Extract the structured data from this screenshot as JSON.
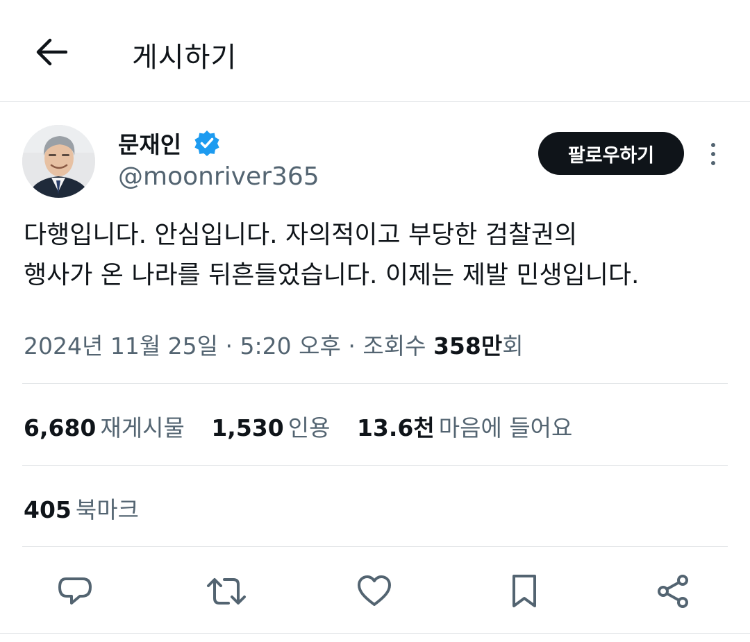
{
  "header": {
    "title": "게시하기",
    "back_icon": "arrow-left-icon"
  },
  "author": {
    "name": "문재인",
    "handle": "@moonriver365",
    "verified": true,
    "verified_color": "#1d9bf0"
  },
  "follow_button": {
    "label": "팔로우하기"
  },
  "tweet": {
    "lines": [
      "다행입니다. 안심입니다. 자의적이고 부당한 검찰권의",
      "행사가 온 나라를 뒤흔들었습니다. 이제는 제발 민생입니다."
    ]
  },
  "meta": {
    "date": "2024년 11월 25일",
    "separator": "·",
    "time": "5:20 오후",
    "views_label": "조회수",
    "views_count": "358만",
    "views_suffix": "회"
  },
  "stats": [
    {
      "count": "6,680",
      "label": "재게시물"
    },
    {
      "count": "1,530",
      "label": "인용"
    },
    {
      "count": "13.6천",
      "label": "마음에 들어요"
    }
  ],
  "bookmarks": {
    "count": "405",
    "label": "북마크"
  },
  "actions": [
    "reply-icon",
    "retweet-icon",
    "like-icon",
    "bookmark-icon",
    "share-icon"
  ],
  "colors": {
    "text": "#0f1419",
    "secondary": "#536471",
    "divider": "#e3e6e8",
    "button_bg": "#0f1419"
  }
}
